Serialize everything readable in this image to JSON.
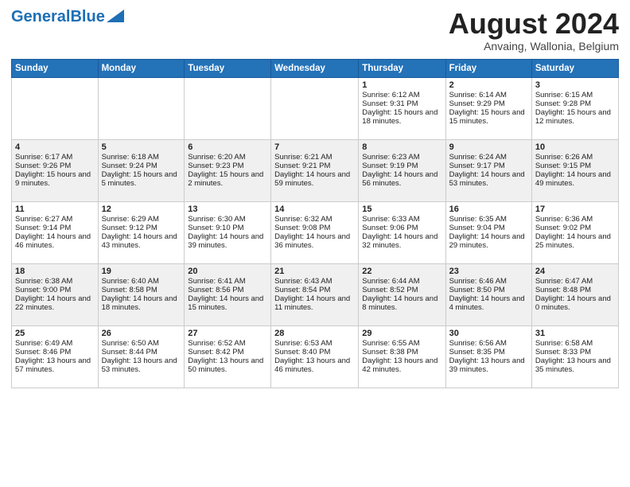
{
  "header": {
    "logo_general": "General",
    "logo_blue": "Blue",
    "month_title": "August 2024",
    "location": "Anvaing, Wallonia, Belgium"
  },
  "weekdays": [
    "Sunday",
    "Monday",
    "Tuesday",
    "Wednesday",
    "Thursday",
    "Friday",
    "Saturday"
  ],
  "weeks": [
    [
      {
        "day": "",
        "sunrise": "",
        "sunset": "",
        "daylight": ""
      },
      {
        "day": "",
        "sunrise": "",
        "sunset": "",
        "daylight": ""
      },
      {
        "day": "",
        "sunrise": "",
        "sunset": "",
        "daylight": ""
      },
      {
        "day": "",
        "sunrise": "",
        "sunset": "",
        "daylight": ""
      },
      {
        "day": "1",
        "sunrise": "Sunrise: 6:12 AM",
        "sunset": "Sunset: 9:31 PM",
        "daylight": "Daylight: 15 hours and 18 minutes."
      },
      {
        "day": "2",
        "sunrise": "Sunrise: 6:14 AM",
        "sunset": "Sunset: 9:29 PM",
        "daylight": "Daylight: 15 hours and 15 minutes."
      },
      {
        "day": "3",
        "sunrise": "Sunrise: 6:15 AM",
        "sunset": "Sunset: 9:28 PM",
        "daylight": "Daylight: 15 hours and 12 minutes."
      }
    ],
    [
      {
        "day": "4",
        "sunrise": "Sunrise: 6:17 AM",
        "sunset": "Sunset: 9:26 PM",
        "daylight": "Daylight: 15 hours and 9 minutes."
      },
      {
        "day": "5",
        "sunrise": "Sunrise: 6:18 AM",
        "sunset": "Sunset: 9:24 PM",
        "daylight": "Daylight: 15 hours and 5 minutes."
      },
      {
        "day": "6",
        "sunrise": "Sunrise: 6:20 AM",
        "sunset": "Sunset: 9:23 PM",
        "daylight": "Daylight: 15 hours and 2 minutes."
      },
      {
        "day": "7",
        "sunrise": "Sunrise: 6:21 AM",
        "sunset": "Sunset: 9:21 PM",
        "daylight": "Daylight: 14 hours and 59 minutes."
      },
      {
        "day": "8",
        "sunrise": "Sunrise: 6:23 AM",
        "sunset": "Sunset: 9:19 PM",
        "daylight": "Daylight: 14 hours and 56 minutes."
      },
      {
        "day": "9",
        "sunrise": "Sunrise: 6:24 AM",
        "sunset": "Sunset: 9:17 PM",
        "daylight": "Daylight: 14 hours and 53 minutes."
      },
      {
        "day": "10",
        "sunrise": "Sunrise: 6:26 AM",
        "sunset": "Sunset: 9:15 PM",
        "daylight": "Daylight: 14 hours and 49 minutes."
      }
    ],
    [
      {
        "day": "11",
        "sunrise": "Sunrise: 6:27 AM",
        "sunset": "Sunset: 9:14 PM",
        "daylight": "Daylight: 14 hours and 46 minutes."
      },
      {
        "day": "12",
        "sunrise": "Sunrise: 6:29 AM",
        "sunset": "Sunset: 9:12 PM",
        "daylight": "Daylight: 14 hours and 43 minutes."
      },
      {
        "day": "13",
        "sunrise": "Sunrise: 6:30 AM",
        "sunset": "Sunset: 9:10 PM",
        "daylight": "Daylight: 14 hours and 39 minutes."
      },
      {
        "day": "14",
        "sunrise": "Sunrise: 6:32 AM",
        "sunset": "Sunset: 9:08 PM",
        "daylight": "Daylight: 14 hours and 36 minutes."
      },
      {
        "day": "15",
        "sunrise": "Sunrise: 6:33 AM",
        "sunset": "Sunset: 9:06 PM",
        "daylight": "Daylight: 14 hours and 32 minutes."
      },
      {
        "day": "16",
        "sunrise": "Sunrise: 6:35 AM",
        "sunset": "Sunset: 9:04 PM",
        "daylight": "Daylight: 14 hours and 29 minutes."
      },
      {
        "day": "17",
        "sunrise": "Sunrise: 6:36 AM",
        "sunset": "Sunset: 9:02 PM",
        "daylight": "Daylight: 14 hours and 25 minutes."
      }
    ],
    [
      {
        "day": "18",
        "sunrise": "Sunrise: 6:38 AM",
        "sunset": "Sunset: 9:00 PM",
        "daylight": "Daylight: 14 hours and 22 minutes."
      },
      {
        "day": "19",
        "sunrise": "Sunrise: 6:40 AM",
        "sunset": "Sunset: 8:58 PM",
        "daylight": "Daylight: 14 hours and 18 minutes."
      },
      {
        "day": "20",
        "sunrise": "Sunrise: 6:41 AM",
        "sunset": "Sunset: 8:56 PM",
        "daylight": "Daylight: 14 hours and 15 minutes."
      },
      {
        "day": "21",
        "sunrise": "Sunrise: 6:43 AM",
        "sunset": "Sunset: 8:54 PM",
        "daylight": "Daylight: 14 hours and 11 minutes."
      },
      {
        "day": "22",
        "sunrise": "Sunrise: 6:44 AM",
        "sunset": "Sunset: 8:52 PM",
        "daylight": "Daylight: 14 hours and 8 minutes."
      },
      {
        "day": "23",
        "sunrise": "Sunrise: 6:46 AM",
        "sunset": "Sunset: 8:50 PM",
        "daylight": "Daylight: 14 hours and 4 minutes."
      },
      {
        "day": "24",
        "sunrise": "Sunrise: 6:47 AM",
        "sunset": "Sunset: 8:48 PM",
        "daylight": "Daylight: 14 hours and 0 minutes."
      }
    ],
    [
      {
        "day": "25",
        "sunrise": "Sunrise: 6:49 AM",
        "sunset": "Sunset: 8:46 PM",
        "daylight": "Daylight: 13 hours and 57 minutes."
      },
      {
        "day": "26",
        "sunrise": "Sunrise: 6:50 AM",
        "sunset": "Sunset: 8:44 PM",
        "daylight": "Daylight: 13 hours and 53 minutes."
      },
      {
        "day": "27",
        "sunrise": "Sunrise: 6:52 AM",
        "sunset": "Sunset: 8:42 PM",
        "daylight": "Daylight: 13 hours and 50 minutes."
      },
      {
        "day": "28",
        "sunrise": "Sunrise: 6:53 AM",
        "sunset": "Sunset: 8:40 PM",
        "daylight": "Daylight: 13 hours and 46 minutes."
      },
      {
        "day": "29",
        "sunrise": "Sunrise: 6:55 AM",
        "sunset": "Sunset: 8:38 PM",
        "daylight": "Daylight: 13 hours and 42 minutes."
      },
      {
        "day": "30",
        "sunrise": "Sunrise: 6:56 AM",
        "sunset": "Sunset: 8:35 PM",
        "daylight": "Daylight: 13 hours and 39 minutes."
      },
      {
        "day": "31",
        "sunrise": "Sunrise: 6:58 AM",
        "sunset": "Sunset: 8:33 PM",
        "daylight": "Daylight: 13 hours and 35 minutes."
      }
    ]
  ]
}
